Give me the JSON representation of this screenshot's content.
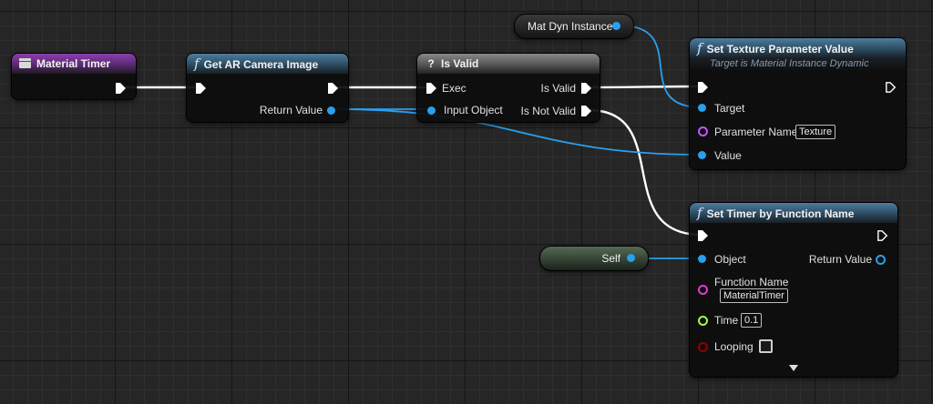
{
  "nodes": {
    "material_timer": {
      "title": "Material Timer"
    },
    "get_ar_camera": {
      "title": "Get AR Camera Image",
      "return_value": "Return Value"
    },
    "is_valid": {
      "title": "Is Valid",
      "exec": "Exec",
      "input_object": "Input Object",
      "is_valid": "Is Valid",
      "is_not_valid": "Is Not Valid"
    },
    "mat_dyn": {
      "label": "Mat Dyn Instance"
    },
    "set_texture": {
      "title": "Set Texture Parameter Value",
      "subtitle": "Target is Material Instance Dynamic",
      "target": "Target",
      "parameter_name": "Parameter Name",
      "parameter_value": "Texture",
      "value": "Value"
    },
    "self_node": {
      "label": "Self"
    },
    "set_timer": {
      "title": "Set Timer by Function Name",
      "object": "Object",
      "return_value": "Return Value",
      "function_name": "Function Name",
      "function_value": "MaterialTimer",
      "time": "Time",
      "time_value": "0.1",
      "looping": "Looping",
      "looping_checked": false
    }
  },
  "icons": {
    "function": "f",
    "macro": "?",
    "exec_pin": "exec-arrow",
    "event": "event-icon",
    "expand": "triangle-down"
  },
  "colors": {
    "graph_bg": "#262626",
    "object_pin": "#29a0ee",
    "name_pin": "#c456ff",
    "float_pin": "#9fff44",
    "bool_pin": "#930000",
    "exec_pin": "#ffffff",
    "function_header": "#4e7c9c",
    "event_header": "#8c3fae"
  }
}
